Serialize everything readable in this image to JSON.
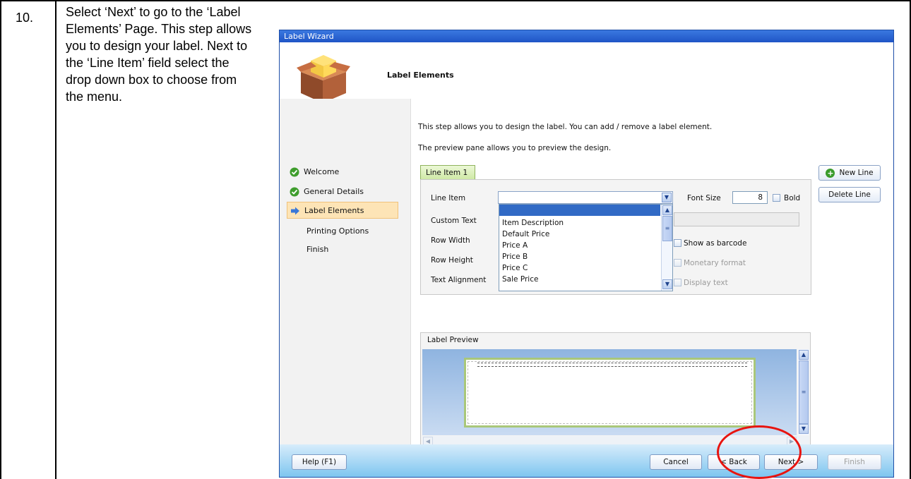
{
  "step": {
    "number": "10.",
    "instruction": "Select ‘Next’ to go to the ‘Label Elements’ Page. This step allows you to design your label. Next to the ‘Line Item’ field select the drop down box to choose from the menu."
  },
  "window": {
    "title": "Label Wizard",
    "header_title": "Label Elements",
    "icon": "package-box-icon"
  },
  "sidebar": {
    "items": [
      {
        "label": "Welcome",
        "icon": "check-icon",
        "state": "done"
      },
      {
        "label": "General Details",
        "icon": "check-icon",
        "state": "done"
      },
      {
        "label": "Label Elements",
        "icon": "arrow-right-icon",
        "state": "active"
      },
      {
        "label": "Printing Options",
        "state": "pending"
      },
      {
        "label": "Finish",
        "state": "pending"
      }
    ]
  },
  "content": {
    "intro_line1": "This step allows you to design the label. You can add / remove a label element.",
    "intro_line2": "The preview pane allows you to preview the design.",
    "tab_label": "Line Item 1",
    "fields": {
      "line_item": "Line Item",
      "custom_text": "Custom Text",
      "row_width": "Row Width",
      "row_height": "Row Height",
      "text_alignment": "Text Alignment",
      "font_size_label": "Font Size",
      "font_size_value": "8",
      "bold": "Bold",
      "show_as_barcode": "Show as barcode",
      "monetary_format": "Monetary format",
      "display_text": "Display text"
    },
    "dropdown_options": [
      "",
      "Item Description",
      "Default Price",
      "Price A",
      "Price B",
      "Price C",
      "Sale Price"
    ],
    "buttons": {
      "new_line": "New Line",
      "delete_line": "Delete Line"
    },
    "preview_title": "Label Preview"
  },
  "footer": {
    "help": "Help (F1)",
    "cancel": "Cancel",
    "back": "< Back",
    "next": "Next >",
    "finish": "Finish"
  },
  "colors": {
    "highlight_circle": "#e8140f",
    "selection": "#316ac5",
    "active_nav": "#fde4b6"
  }
}
